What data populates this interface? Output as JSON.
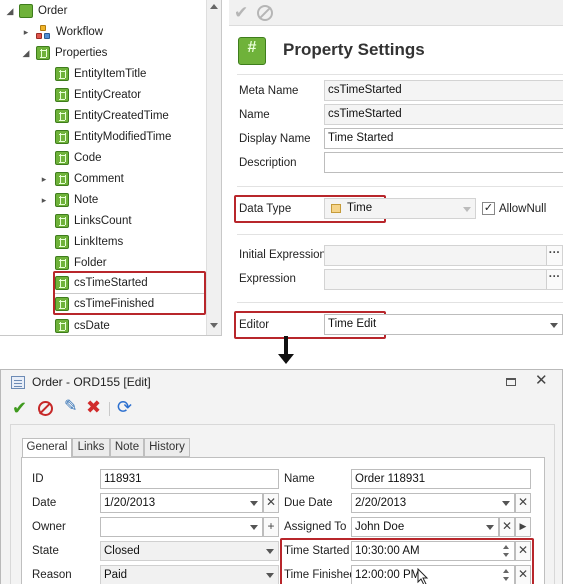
{
  "tree": {
    "items": [
      {
        "label": "Order",
        "icon": "order-icon",
        "expanded": true
      },
      {
        "label": "Workflow",
        "icon": "workflow-icon",
        "expanded": false
      },
      {
        "label": "Properties",
        "icon": "property-icon",
        "expanded": true
      },
      {
        "label": "EntityItemTitle",
        "icon": "property-icon"
      },
      {
        "label": "EntityCreator",
        "icon": "property-icon"
      },
      {
        "label": "EntityCreatedTime",
        "icon": "property-icon"
      },
      {
        "label": "EntityModifiedTime",
        "icon": "property-icon"
      },
      {
        "label": "Code",
        "icon": "property-icon"
      },
      {
        "label": "Comment",
        "icon": "property-icon",
        "expanded": false
      },
      {
        "label": "Note",
        "icon": "property-icon",
        "expanded": false
      },
      {
        "label": "LinksCount",
        "icon": "property-icon"
      },
      {
        "label": "LinkItems",
        "icon": "property-icon"
      },
      {
        "label": "Folder",
        "icon": "property-icon"
      },
      {
        "label": "csTimeStarted",
        "icon": "property-icon",
        "highlighted": true,
        "selected": true
      },
      {
        "label": "csTimeFinished",
        "icon": "property-icon",
        "highlighted": true
      },
      {
        "label": "csDate",
        "icon": "property-icon"
      }
    ]
  },
  "property_settings": {
    "title": "Property Settings",
    "meta_name_label": "Meta Name",
    "meta_name_value": "csTimeStarted",
    "name_label": "Name",
    "name_value": "csTimeStarted",
    "display_name_label": "Display Name",
    "display_name_value": "Time Started",
    "description_label": "Description",
    "description_value": "",
    "data_type_label": "Data Type",
    "data_type_value": "Time",
    "allow_null_label": "AllowNull",
    "allow_null_checked": true,
    "initial_expression_label": "Initial Expression",
    "expression_label": "Expression",
    "editor_label": "Editor",
    "editor_value": "Time Edit",
    "ellipsis": "···"
  },
  "window": {
    "title": "Order - ORD155 [Edit]",
    "tabs": [
      "General",
      "Links",
      "Note",
      "History"
    ],
    "active_tab": "General",
    "fields": {
      "id_label": "ID",
      "id_value": "118931",
      "name_label": "Name",
      "name_value": "Order 118931",
      "date_label": "Date",
      "date_value": "1/20/2013",
      "due_date_label": "Due Date",
      "due_date_value": "2/20/2013",
      "owner_label": "Owner",
      "owner_value": "",
      "assigned_to_label": "Assigned To",
      "assigned_to_value": "John Doe",
      "state_label": "State",
      "state_value": "Closed",
      "reason_label": "Reason",
      "reason_value": "Paid",
      "time_started_label": "Time Started",
      "time_started_value": "10:30:00 AM",
      "time_finished_label": "Time Finished",
      "time_finished_value": "12:00:00 PM"
    }
  },
  "colors": {
    "highlight": "#b8262b",
    "property_icon": "#6fb23a",
    "accept": "#3f9a1e",
    "cancel": "#c62828",
    "refresh": "#2b6fcf"
  }
}
